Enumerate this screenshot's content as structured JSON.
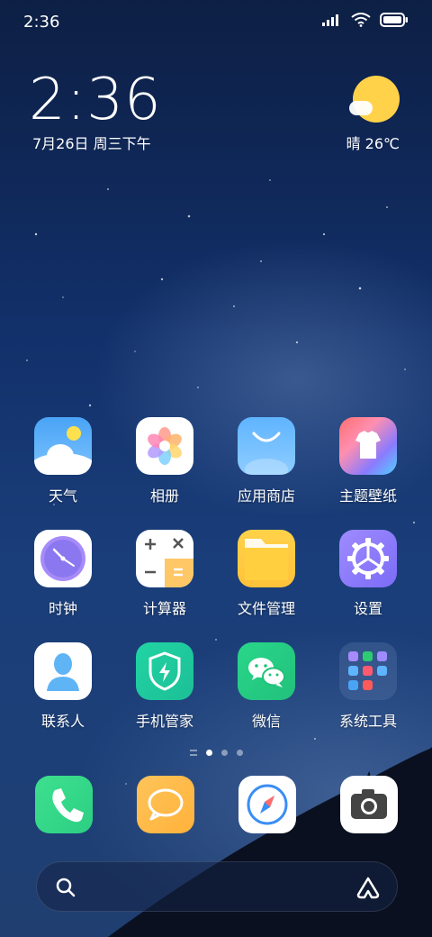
{
  "status_bar": {
    "time": "2:36"
  },
  "clock_widget": {
    "time": "2:36",
    "date": "7月26日 周三下午"
  },
  "weather": {
    "text": "晴 26℃"
  },
  "apps": [
    {
      "label": "天气",
      "icon": "weather-icon"
    },
    {
      "label": "相册",
      "icon": "gallery-icon"
    },
    {
      "label": "应用商店",
      "icon": "app-store-icon"
    },
    {
      "label": "主题壁纸",
      "icon": "themes-icon"
    },
    {
      "label": "时钟",
      "icon": "clock-icon"
    },
    {
      "label": "计算器",
      "icon": "calculator-icon"
    },
    {
      "label": "文件管理",
      "icon": "file-manager-icon"
    },
    {
      "label": "设置",
      "icon": "settings-icon"
    },
    {
      "label": "联系人",
      "icon": "contacts-icon"
    },
    {
      "label": "手机管家",
      "icon": "security-icon"
    },
    {
      "label": "微信",
      "icon": "wechat-icon"
    },
    {
      "label": "系统工具",
      "icon": "system-tools-folder-icon"
    }
  ],
  "page_indicator": {
    "pages": 3,
    "active": 1
  },
  "dock": [
    {
      "icon": "phone-icon"
    },
    {
      "icon": "messages-icon"
    },
    {
      "icon": "browser-icon"
    },
    {
      "icon": "camera-icon"
    }
  ],
  "colors": {
    "sun": "#ffd24a",
    "wallpaper_top": "#0d1f44",
    "wallpaper_bottom": "#203f70"
  }
}
